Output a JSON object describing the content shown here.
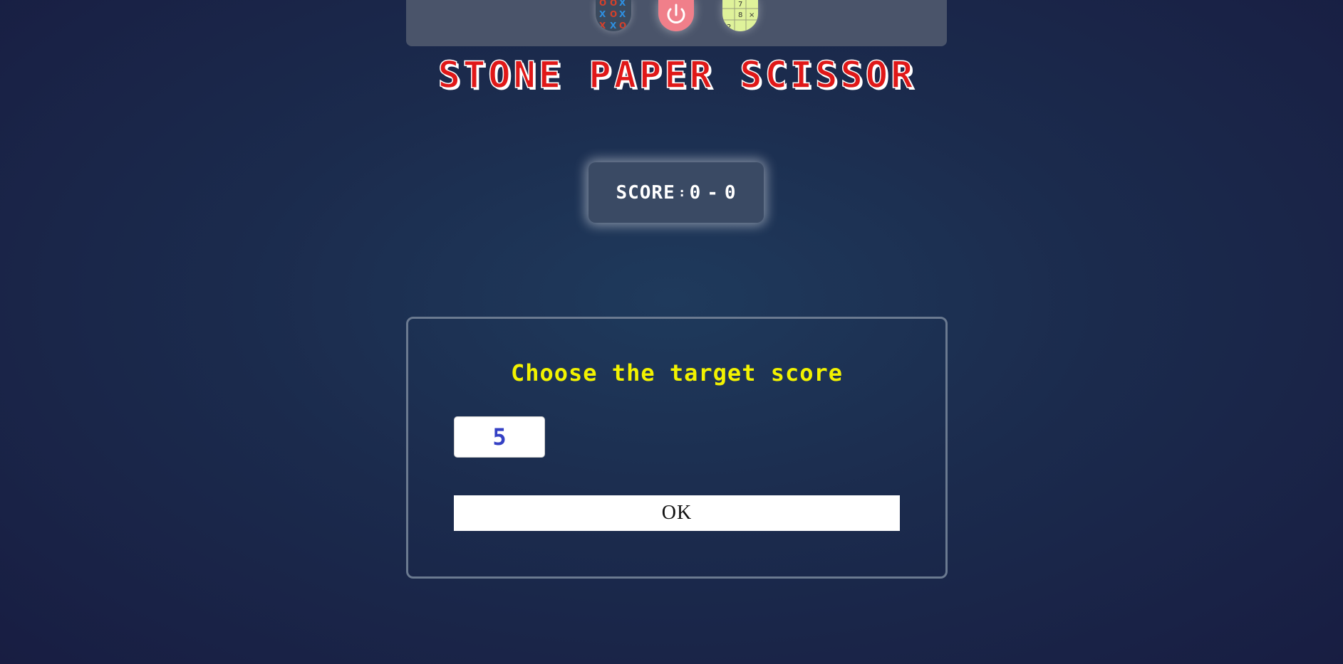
{
  "header": {
    "icons": [
      {
        "name": "tic-tac-toe-icon"
      },
      {
        "name": "power-icon"
      },
      {
        "name": "sudoku-icon"
      }
    ]
  },
  "game": {
    "title": "STONE PAPER SCISSOR",
    "score": {
      "label": "SCORE",
      "separator": ":",
      "player": "0",
      "dash": "-",
      "computer": "0"
    }
  },
  "dialog": {
    "prompt": "Choose the target score",
    "target_value": "5",
    "ok_label": "OK"
  },
  "colors": {
    "title_red": "#e01818",
    "prompt_yellow": "#f2f200",
    "input_value_blue": "#3440c4",
    "power_icon_pink": "#f07f8a",
    "sudoku_icon_green": "#dff29a",
    "topbar": "#4a546a",
    "score_box": "#3a4a64"
  }
}
